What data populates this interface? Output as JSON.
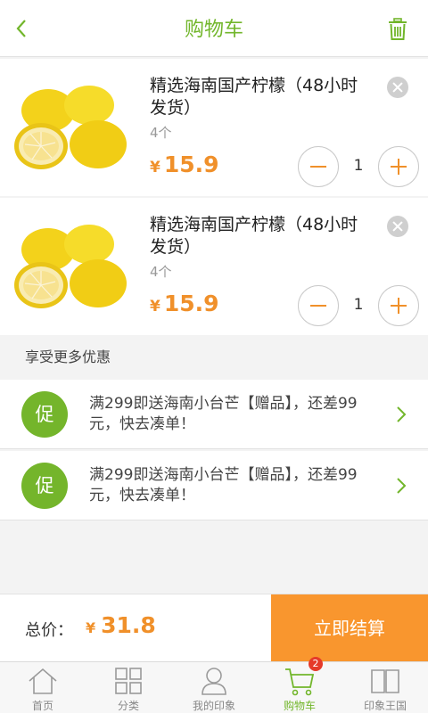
{
  "header": {
    "title": "购物车"
  },
  "colors": {
    "accent_green": "#72b62b",
    "price_orange": "#f0902a",
    "checkout_orange": "#f9962e",
    "badge_red": "#e53a2a"
  },
  "cart": {
    "items": [
      {
        "name": "精选海南国产柠檬（48小时发货）",
        "unit": "4个",
        "currency": "¥",
        "price": "15.9",
        "quantity": "1"
      },
      {
        "name": "精选海南国产柠檬（48小时发货）",
        "unit": "4个",
        "currency": "¥",
        "price": "15.9",
        "quantity": "1"
      }
    ]
  },
  "promotions": {
    "heading": "享受更多优惠",
    "items": [
      {
        "badge": "促",
        "text": "满299即送海南小台芒【赠品】，还差99元，快去凑单！"
      },
      {
        "badge": "促",
        "text": "满299即送海南小台芒【赠品】，还差99元，快去凑单！"
      }
    ]
  },
  "checkout": {
    "total_label": "总价：",
    "currency": "¥",
    "total": "31.8",
    "button": "立即结算"
  },
  "tabbar": {
    "tabs": [
      {
        "label": "首页",
        "icon": "home-icon"
      },
      {
        "label": "分类",
        "icon": "grid-icon"
      },
      {
        "label": "我的印象",
        "icon": "user-icon"
      },
      {
        "label": "购物车",
        "icon": "cart-icon",
        "badge": "2",
        "active": true
      },
      {
        "label": "印象王国",
        "icon": "book-icon"
      }
    ]
  }
}
